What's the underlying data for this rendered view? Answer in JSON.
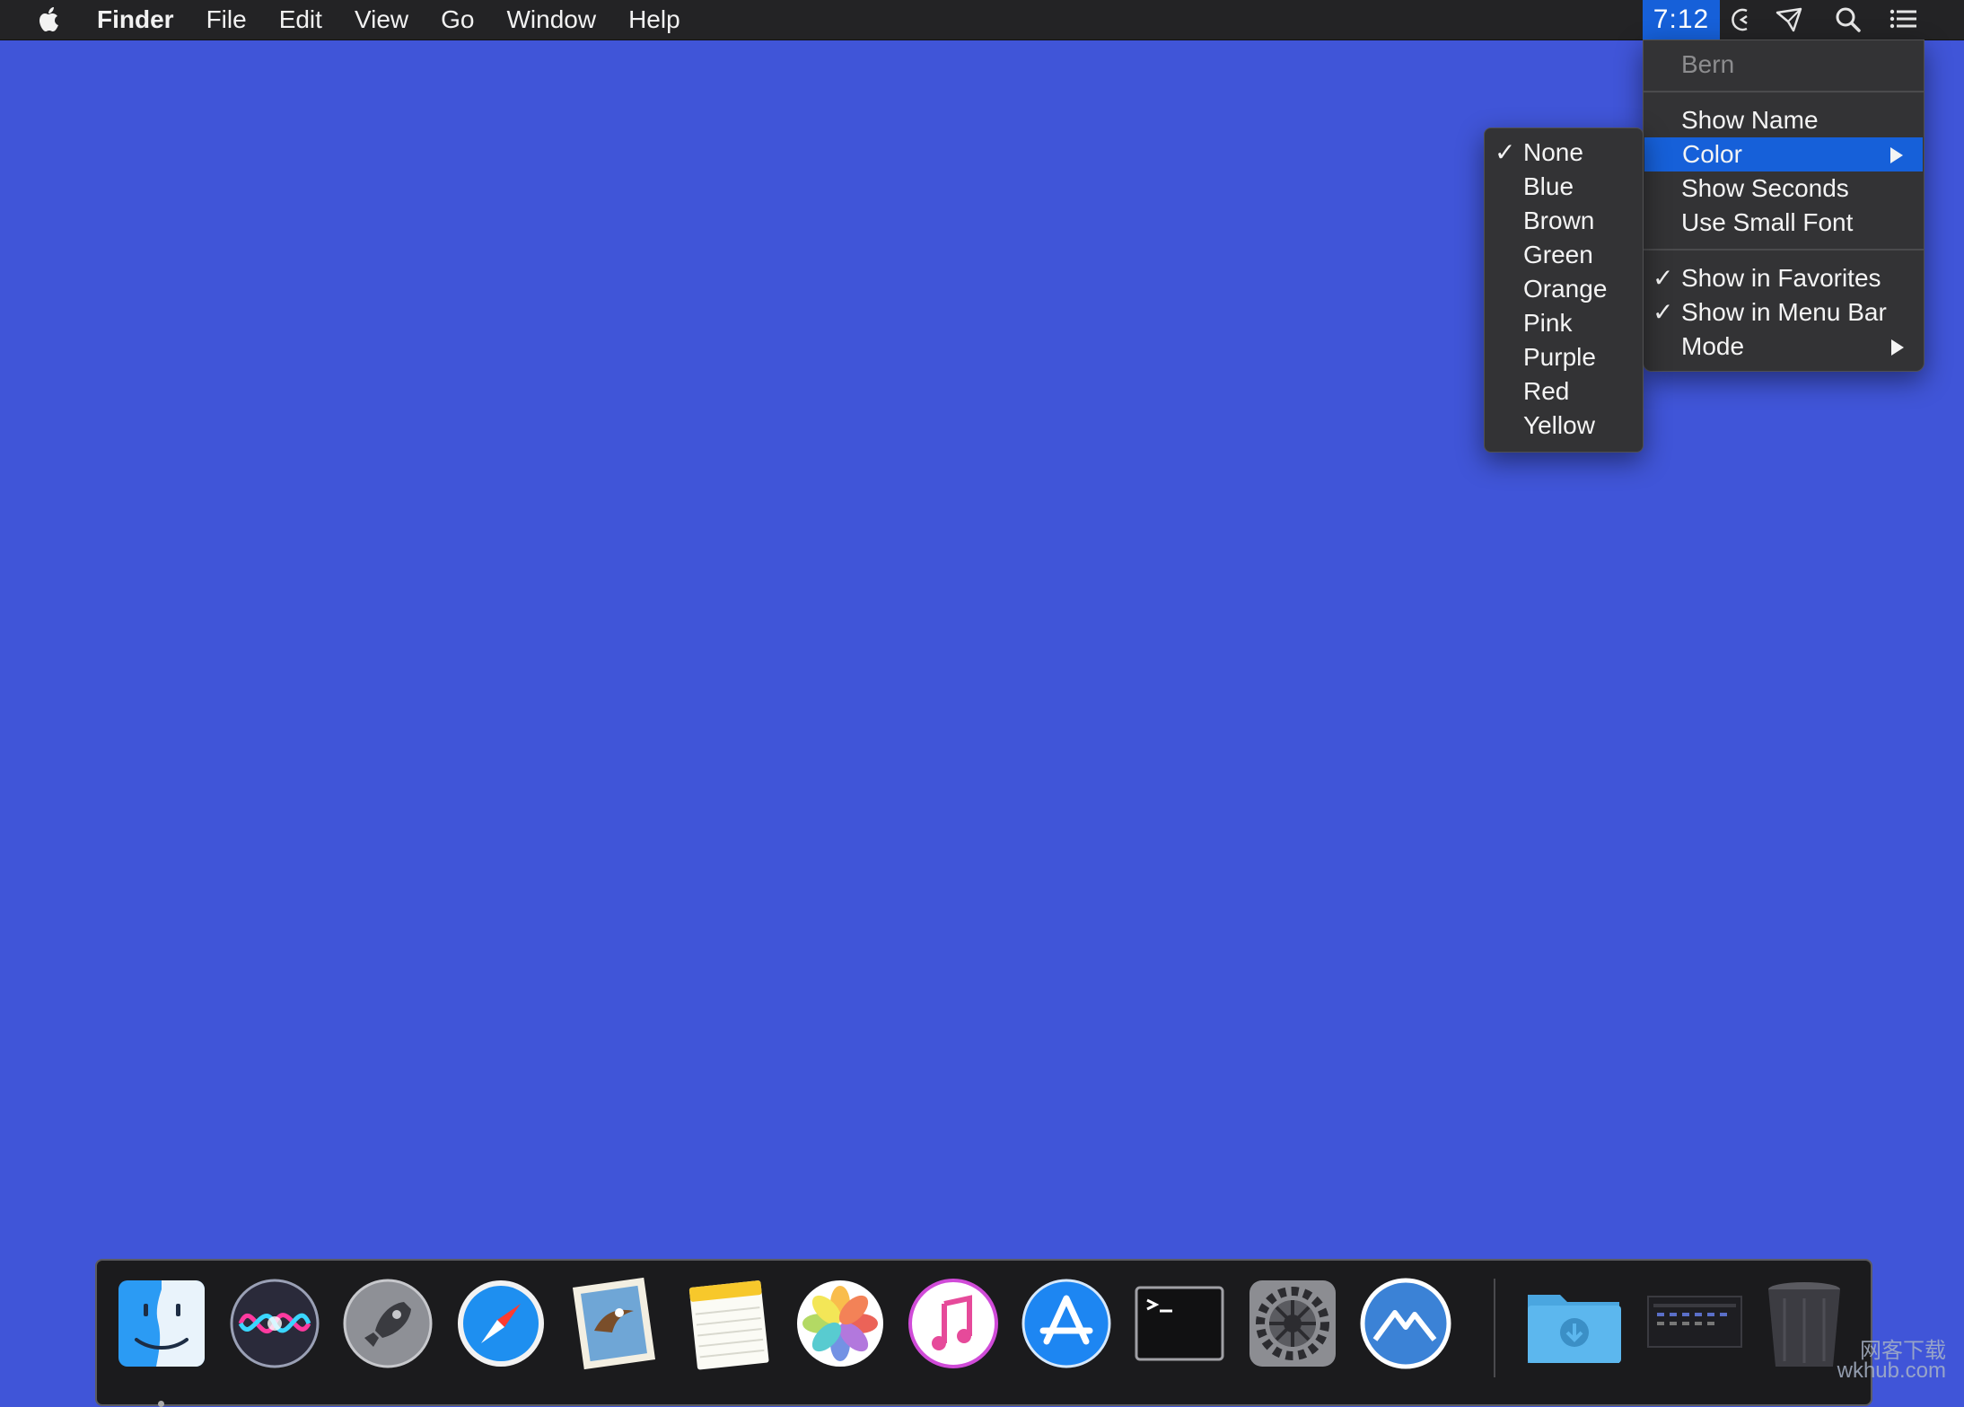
{
  "menubar": {
    "app_name": "Finder",
    "items": [
      "File",
      "Edit",
      "View",
      "Go",
      "Window",
      "Help"
    ],
    "clock": "7:12"
  },
  "clock_menu": {
    "header": "Bern",
    "items": {
      "show_name": "Show Name",
      "color": "Color",
      "show_seconds": "Show Seconds",
      "use_small_font": "Use Small Font",
      "show_in_favorites": "Show in Favorites",
      "show_in_menu_bar": "Show in Menu Bar",
      "mode": "Mode"
    },
    "checked": [
      "Show in Favorites",
      "Show in Menu Bar"
    ],
    "highlighted": "Color"
  },
  "color_submenu": {
    "items": [
      "None",
      "Blue",
      "Brown",
      "Green",
      "Orange",
      "Pink",
      "Purple",
      "Red",
      "Yellow"
    ],
    "checked": "None"
  },
  "check_glyph": "✓",
  "dock": {
    "apps": [
      "Finder",
      "Siri",
      "Launchpad",
      "Safari",
      "Mail",
      "Notes",
      "Photos",
      "iTunes",
      "App Store",
      "Terminal",
      "System Preferences",
      "Monterey"
    ],
    "right": [
      "Downloads",
      "Screenshot",
      "Trash"
    ]
  },
  "watermark": [
    "网客下载",
    "wkhub.com"
  ],
  "colors": {
    "desktop": "#4055d8",
    "menubar": "#232325",
    "menu": "#333335",
    "highlight": "#1660d9"
  }
}
